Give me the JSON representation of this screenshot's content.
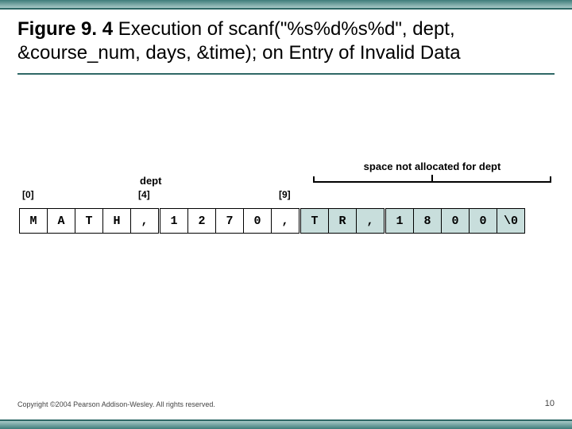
{
  "title": {
    "lead": "Figure 9. 4",
    "rest": "  Execution of scanf(\"%s%d%s%d\", dept, &course_num, days, &time); on Entry of Invalid Data"
  },
  "diagram": {
    "dept_label": "dept",
    "index_labels": {
      "i0": "[0]",
      "i4": "[4]",
      "i9": "[9]"
    },
    "overflow_label": "space not allocated for dept",
    "cells": [
      {
        "v": "M",
        "of": false
      },
      {
        "v": "A",
        "of": false
      },
      {
        "v": "T",
        "of": false
      },
      {
        "v": "H",
        "of": false
      },
      {
        "v": ",",
        "of": false
      },
      {
        "v": "1",
        "of": false
      },
      {
        "v": "2",
        "of": false
      },
      {
        "v": "7",
        "of": false
      },
      {
        "v": "0",
        "of": false
      },
      {
        "v": ",",
        "of": false
      },
      {
        "v": "T",
        "of": true
      },
      {
        "v": "R",
        "of": true
      },
      {
        "v": ",",
        "of": true
      },
      {
        "v": "1",
        "of": true
      },
      {
        "v": "8",
        "of": true
      },
      {
        "v": "0",
        "of": true
      },
      {
        "v": "0",
        "of": true
      },
      {
        "v": "\\0",
        "of": true
      }
    ]
  },
  "footer": "Copyright ©2004 Pearson Addison-Wesley. All rights reserved.",
  "page_number": "10"
}
